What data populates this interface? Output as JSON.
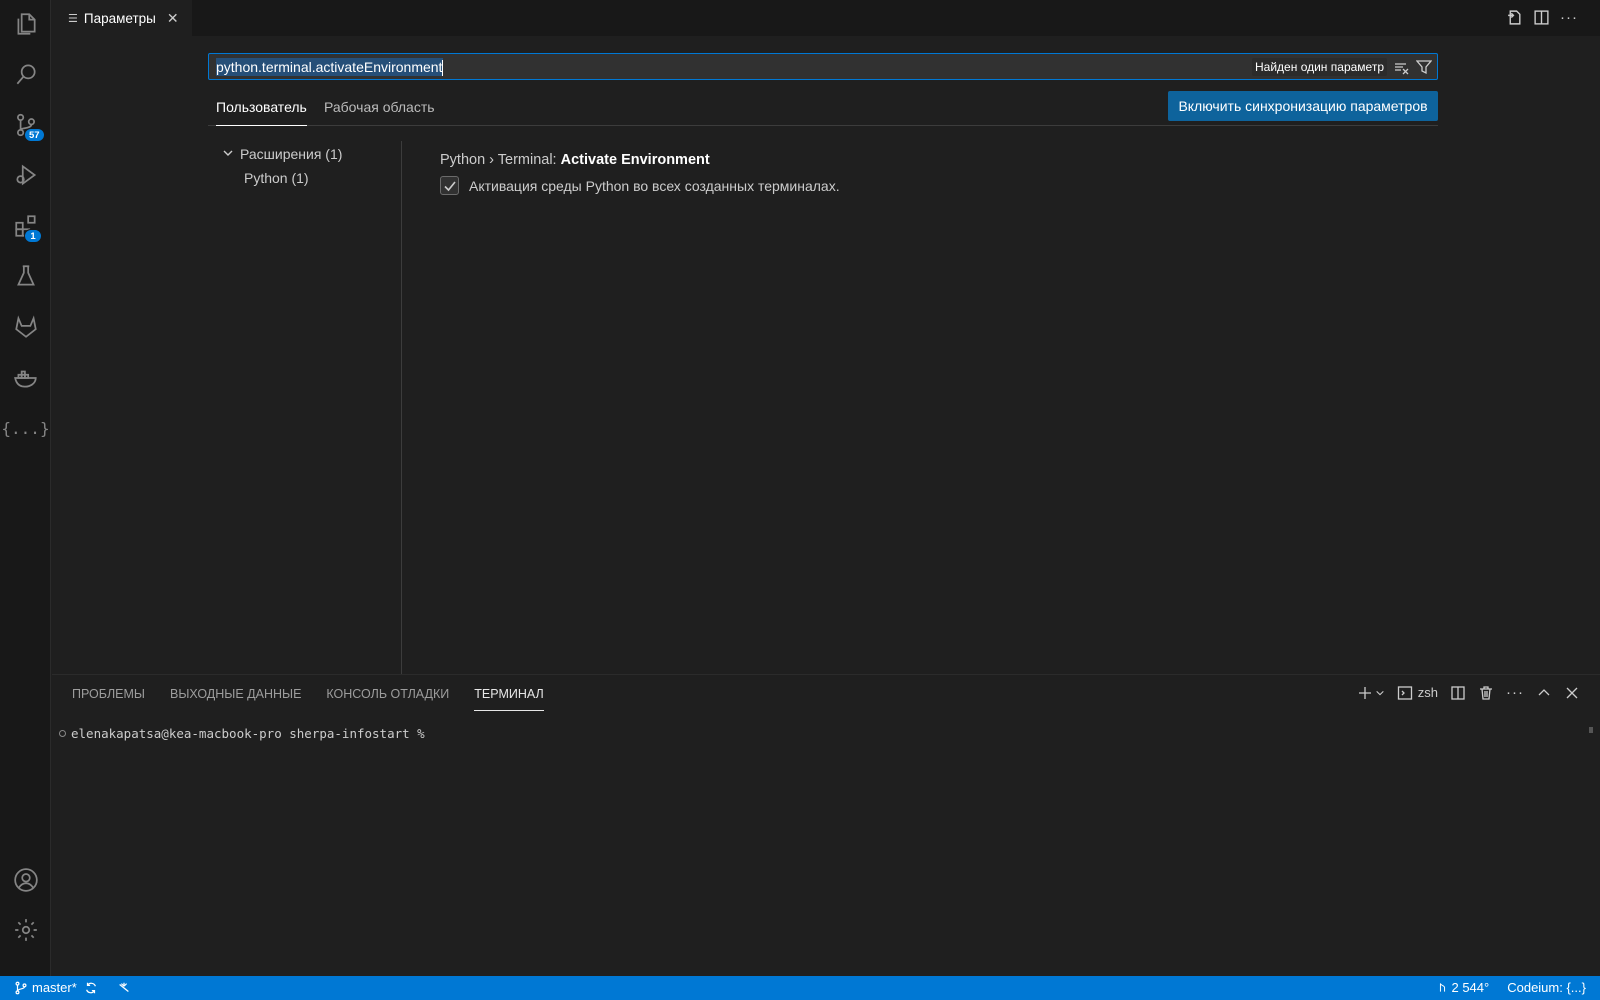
{
  "activity_bar": {
    "items": [
      {
        "icon": "explorer-icon"
      },
      {
        "icon": "search-icon"
      },
      {
        "icon": "source-control-icon",
        "badge": "57"
      },
      {
        "icon": "run-debug-icon"
      },
      {
        "icon": "extensions-icon",
        "badge": "1"
      },
      {
        "icon": "testing-icon"
      },
      {
        "icon": "gitlab-icon"
      },
      {
        "icon": "docker-icon"
      },
      {
        "icon": "json-icon",
        "glyph": "{...}"
      }
    ],
    "bottom": [
      {
        "icon": "account-icon"
      },
      {
        "icon": "manage-gear-icon"
      }
    ]
  },
  "editor": {
    "tab": {
      "label": "Параметры",
      "icon": "settings-list-icon",
      "close": "✕"
    },
    "actions": [
      "open-settings-json-icon",
      "split-editor-icon",
      "more-actions-icon"
    ],
    "more": "···"
  },
  "settings": {
    "search": {
      "value": "python.terminal.activateEnvironment",
      "result_count": "Найден один параметр"
    },
    "scope_tabs": [
      {
        "label": "Пользователь",
        "active": true
      },
      {
        "label": "Рабочая область",
        "active": false
      }
    ],
    "sync_button": "Включить синхронизацию параметров",
    "toc": [
      {
        "label": "Расширения (1)",
        "expanded": true
      },
      {
        "label": "Python (1)"
      }
    ],
    "setting": {
      "category": "Python › Terminal: ",
      "name": "Activate Environment",
      "description": "Активация среды Python во всех созданных терминалах.",
      "checked": true
    }
  },
  "panel": {
    "tabs": [
      {
        "label": "ПРОБЛЕМЫ",
        "active": false
      },
      {
        "label": "ВЫХОДНЫЕ ДАННЫЕ",
        "active": false
      },
      {
        "label": "КОНСОЛЬ ОТЛАДКИ",
        "active": false
      },
      {
        "label": "ТЕРМИНАЛ",
        "active": true
      }
    ],
    "terminal_shell": "zsh",
    "more": "···",
    "terminal_prompt": "elenakapatsa@kea-macbook-pro sherpa-infostart %"
  },
  "status_bar": {
    "branch": "master*",
    "git_stat": "2 544°",
    "codeium": "Codeium: {...}",
    "color": "#0078d4"
  }
}
